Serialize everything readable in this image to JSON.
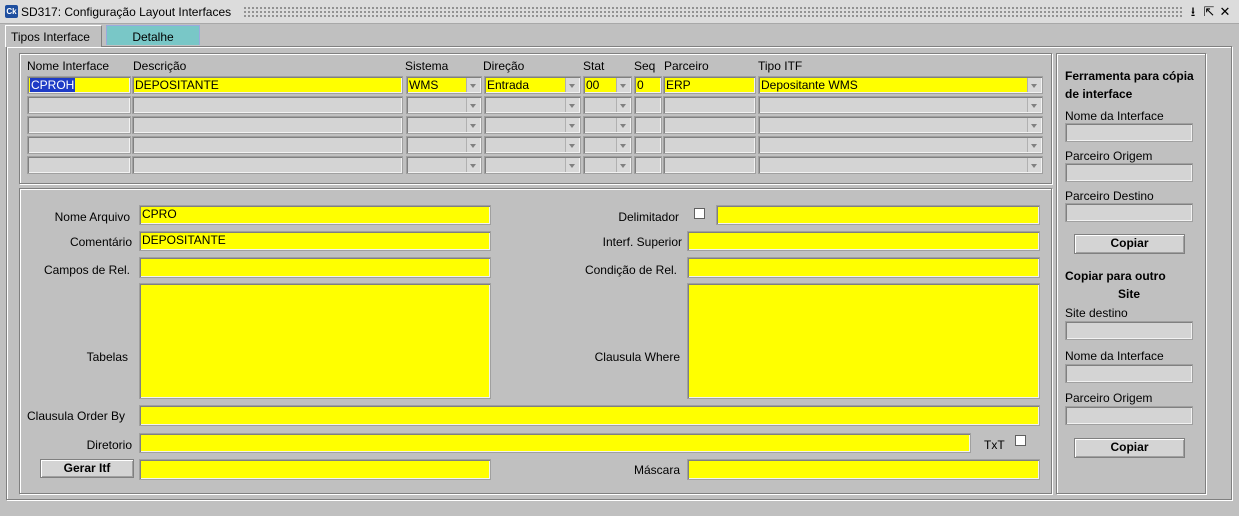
{
  "window": {
    "title": "SD317: Configuração Layout Interfaces",
    "icon_text": "Ck",
    "minimize_glyph": "⭳",
    "restore_glyph": "⇱",
    "close_glyph": "✕"
  },
  "tabs": [
    {
      "label": "Tipos Interface",
      "active": true
    },
    {
      "label": "Detalhe",
      "active": false
    }
  ],
  "grid": {
    "headers": {
      "nome": "Nome Interface",
      "descricao": "Descrição",
      "sistema": "Sistema",
      "direcao": "Direção",
      "stat": "Stat",
      "seq": "Seq",
      "parceiro": "Parceiro",
      "tipo_itf": "Tipo ITF"
    },
    "row1": {
      "nome": "CPROH",
      "descricao": "DEPOSITANTE",
      "sistema": "WMS",
      "direcao": "Entrada",
      "stat": "00",
      "seq": "0",
      "parceiro": "ERP",
      "tipo_itf": "Depositante WMS"
    }
  },
  "detail": {
    "nome_arquivo_label": "Nome Arquivo",
    "nome_arquivo_value": "CPRO",
    "comentario_label": "Comentário",
    "comentario_value": "DEPOSITANTE",
    "campos_rel_label": "Campos de Rel.",
    "campos_rel_value": "",
    "tabelas_label": "Tabelas",
    "tabelas_value": "",
    "delimitador_label": "Delimitador",
    "delimitador_value": "",
    "interf_superior_label": "Interf. Superior",
    "interf_superior_value": "",
    "condicao_rel_label": "Condição de Rel.",
    "condicao_rel_value": "",
    "clausula_where_label": "Clausula Where",
    "clausula_where_value": "",
    "clausula_order_label": "Clausula Order By",
    "clausula_order_value": "",
    "diretorio_label": "Diretorio",
    "diretorio_value": "",
    "txt_label": "TxT",
    "gerar_itf_label": "Gerar Itf",
    "gerar_itf_value": "",
    "mascara_label": "Máscara",
    "mascara_value": ""
  },
  "sidebar": {
    "tool_title": "Ferramenta para cópia de interface",
    "nome_interface_label": "Nome da Interface",
    "parceiro_origem_label": "Parceiro Origem",
    "parceiro_destino_label": "Parceiro Destino",
    "copiar_label": "Copiar",
    "site_title_1": "Copiar para outro",
    "site_title_2": "Site",
    "site_destino_label": "Site destino",
    "nome_interface2_label": "Nome da Interface",
    "parceiro_origem2_label": "Parceiro Origem",
    "copiar2_label": "Copiar"
  }
}
